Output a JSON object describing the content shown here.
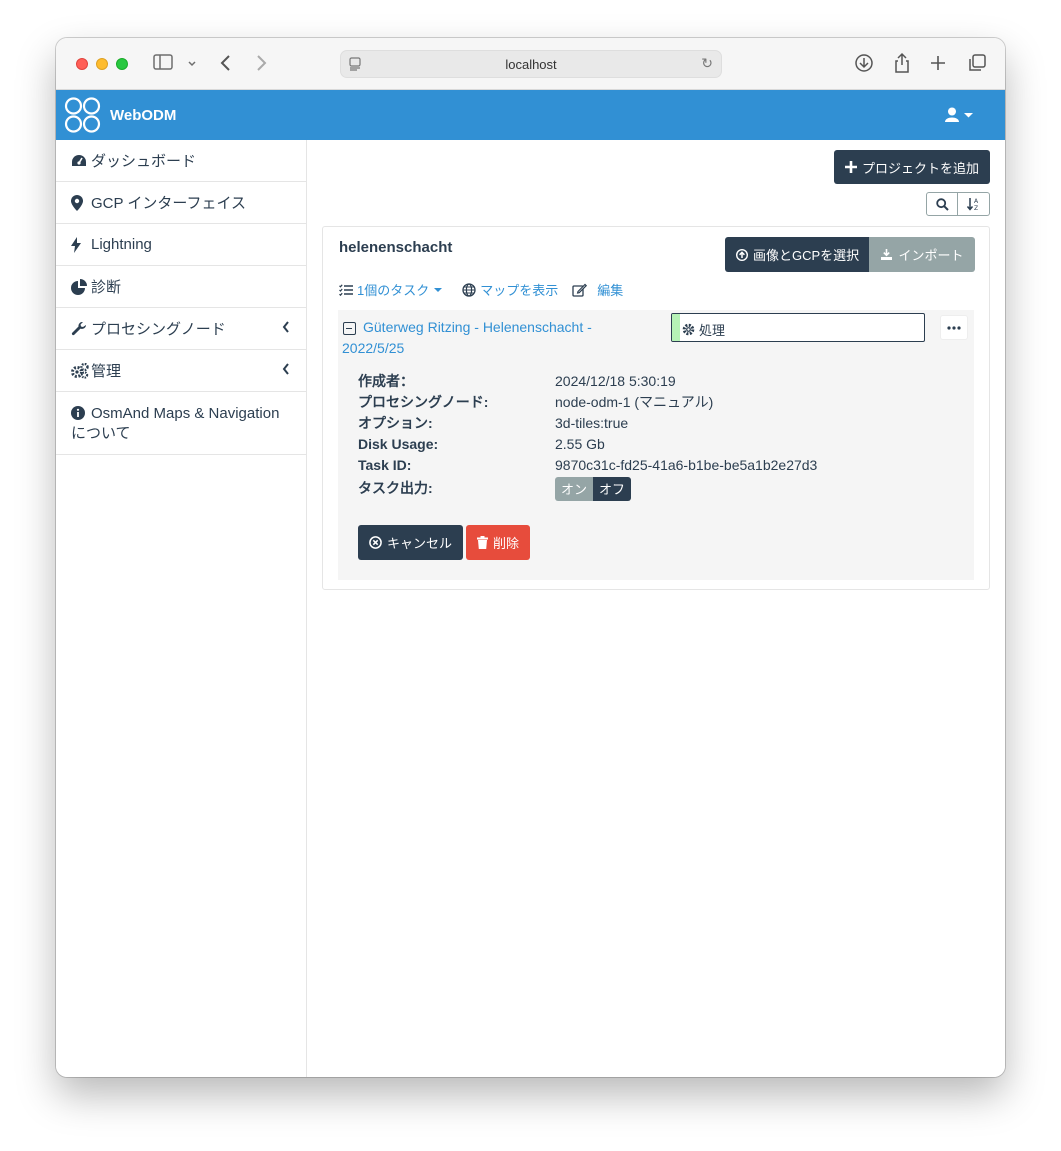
{
  "browser": {
    "url": "localhost"
  },
  "header": {
    "brand": "WebODM"
  },
  "sidebar": {
    "items": [
      {
        "label": "ダッシュボード",
        "icon": "tachometer-icon"
      },
      {
        "label": "GCP インターフェイス",
        "icon": "map-marker-icon"
      },
      {
        "label": "Lightning",
        "icon": "bolt-icon"
      },
      {
        "label": "診断",
        "icon": "pie-chart-icon"
      },
      {
        "label": "プロセシングノード",
        "icon": "wrench-icon",
        "expandable": true
      },
      {
        "label": "管理",
        "icon": "cogs-icon",
        "expandable": true
      },
      {
        "label": "OsmAnd Maps & Navigation について",
        "icon": "info-circle-icon"
      }
    ]
  },
  "content": {
    "add_project_label": "プロジェクトを追加",
    "project": {
      "name": "helenenschacht",
      "select_label": "画像とGCPを選択",
      "import_label": "インポート",
      "tasks_link": "1個のタスク",
      "map_link": "マップを表示",
      "edit_link": "編集",
      "task": {
        "title": "Güterweg Ritzing - Helenenschacht - 2022/5/25",
        "status": "処理",
        "progress": 0.03,
        "details": [
          {
            "label": "作成者：",
            "value": "2024/12/18 5:30:19"
          },
          {
            "label": "プロセシングノード:",
            "value": "node-odm-1 (マニュアル)"
          },
          {
            "label": "オプション:",
            "value": "3d-tiles:true"
          },
          {
            "label": "Disk Usage:",
            "value": "2.55 Gb"
          },
          {
            "label": "Task ID:",
            "value": "9870c31c-fd25-41a6-b1be-be5a1b2e27d3"
          }
        ],
        "output_label": "タスク出力:",
        "output_on": "オン",
        "output_off": "オフ",
        "cancel_label": "キャンセル",
        "delete_label": "削除"
      }
    }
  },
  "colors": {
    "navbar": "#3190d4",
    "primary_dark": "#2c3e50",
    "danger": "#e74c3c",
    "muted": "#95a5a6",
    "link": "#3190d4"
  }
}
